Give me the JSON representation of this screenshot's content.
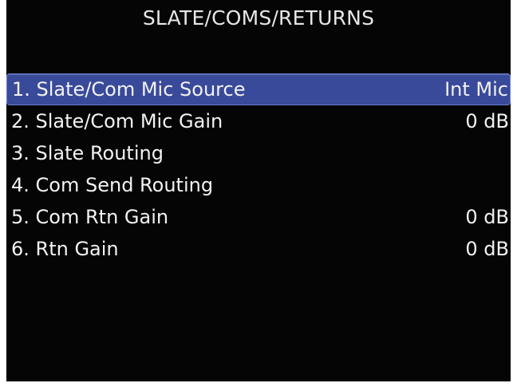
{
  "screen": {
    "title": "SLATE/COMS/RETURNS"
  },
  "menu": {
    "items": [
      {
        "label": "1. Slate/Com Mic Source",
        "value": "Int Mic",
        "selected": true
      },
      {
        "label": "2. Slate/Com Mic Gain",
        "value": "0 dB",
        "selected": false
      },
      {
        "label": "3. Slate Routing",
        "value": "",
        "selected": false
      },
      {
        "label": "4. Com Send Routing",
        "value": "",
        "selected": false
      },
      {
        "label": "5. Com Rtn Gain",
        "value": "0 dB",
        "selected": false
      },
      {
        "label": "6. Rtn Gain",
        "value": "0 dB",
        "selected": false
      }
    ]
  },
  "colors": {
    "screen_background": "#050505",
    "text": "#f2f2f2",
    "selection_highlight": "#3a4a9a"
  }
}
